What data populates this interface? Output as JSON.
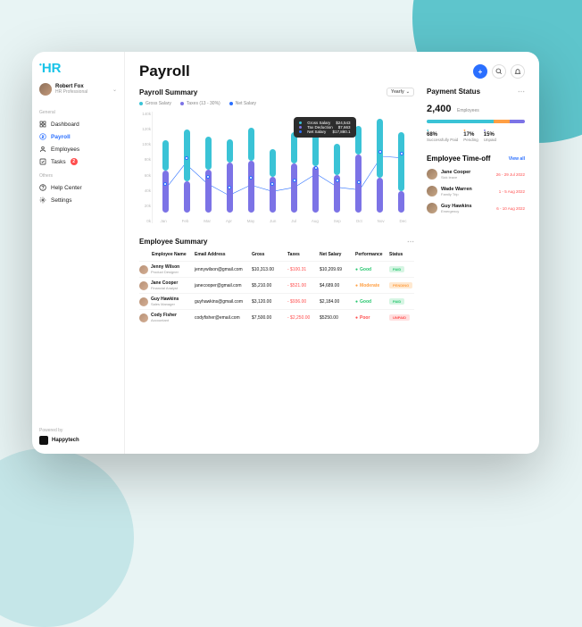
{
  "logo": "HR",
  "user": {
    "name": "Robert Fox",
    "role": "HR Professional"
  },
  "nav": {
    "sections": [
      {
        "label": "General",
        "items": [
          {
            "id": "dashboard",
            "label": "Dashboard",
            "icon": "grid-icon"
          },
          {
            "id": "payroll",
            "label": "Payroll",
            "icon": "dollar-icon",
            "active": true
          },
          {
            "id": "employees",
            "label": "Employees",
            "icon": "user-icon"
          },
          {
            "id": "tasks",
            "label": "Tasks",
            "icon": "check-icon",
            "badge": "2"
          }
        ]
      },
      {
        "label": "Others",
        "items": [
          {
            "id": "help",
            "label": "Help Center",
            "icon": "help-icon"
          },
          {
            "id": "settings",
            "label": "Settings",
            "icon": "gear-icon"
          }
        ]
      }
    ]
  },
  "powered": {
    "label": "Powered by",
    "name": "Happytech"
  },
  "page_title": "Payroll",
  "summary": {
    "title": "Payroll Summary",
    "period_selector": "Yearly",
    "legend": {
      "gross": "Gross Salary",
      "tax": "Taxes (13 - 30%)",
      "net": "Net Salary"
    },
    "tooltip": {
      "gross_label": "Gross Salary",
      "gross_val": "$24,543",
      "tax_label": "Tax Deduction",
      "tax_val": "$7,663",
      "net_label": "Net Salary",
      "net_val": "$17,880.1"
    }
  },
  "chart_data": {
    "type": "bar",
    "title": "Payroll Summary",
    "xlabel": "",
    "ylabel": "",
    "ylim": [
      0,
      140000
    ],
    "yticks": [
      "140k",
      "120k",
      "100k",
      "80k",
      "60k",
      "40k",
      "20k",
      "0k"
    ],
    "categories": [
      "Jan",
      "Feb",
      "Mar",
      "Apr",
      "May",
      "Jun",
      "Jul",
      "Aug",
      "Sep",
      "Oct",
      "Nov",
      "Dec"
    ],
    "series": [
      {
        "name": "Gross Salary",
        "color": "#3ac3d6",
        "values": [
          100000,
          115000,
          105000,
          102000,
          118000,
          88000,
          112000,
          125000,
          95000,
          120000,
          130000,
          112000
        ]
      },
      {
        "name": "Taxes",
        "color": "#7c73e6",
        "values": [
          58000,
          44000,
          60000,
          70000,
          72000,
          50000,
          68000,
          65000,
          52000,
          80000,
          48000,
          30000
        ]
      },
      {
        "name": "Net Salary",
        "color": "#2a6fff",
        "values": [
          40000,
          75000,
          50000,
          35000,
          48000,
          40000,
          45000,
          62000,
          45000,
          42000,
          84000,
          82000
        ]
      }
    ]
  },
  "payment_status": {
    "title": "Payment Status",
    "count": "2,400",
    "count_label": "Employees",
    "segments": [
      {
        "label": "Successfully Paid",
        "pct": 68,
        "color": "#3ac3d6"
      },
      {
        "label": "Pending",
        "pct": 17,
        "color": "#ff9f43"
      },
      {
        "label": "Unpaid",
        "pct": 15,
        "color": "#7c73e6"
      }
    ]
  },
  "timeoff": {
    "title": "Employee Time-off",
    "view_all": "View all",
    "items": [
      {
        "name": "Jane Cooper",
        "reason": "Sick leave",
        "date": "26 - 29 Jul 2022"
      },
      {
        "name": "Wade Warren",
        "reason": "Family Trip",
        "date": "1 - 5 Aug 2022"
      },
      {
        "name": "Guy Hawkins",
        "reason": "Emergency",
        "date": "6 - 10 Aug 2022"
      }
    ]
  },
  "employee_summary": {
    "title": "Employee Summary",
    "columns": [
      "Employee Name",
      "Email Address",
      "Gross",
      "Taxes",
      "Net Salary",
      "Performance",
      "Status"
    ],
    "rows": [
      {
        "name": "Jenny Wilson",
        "role": "Product Designer",
        "email": "jennywilson@gmail.com",
        "gross": "$10,313.00",
        "taxes": "- $100.31",
        "net": "$10,209.69",
        "perf": "Good",
        "perf_class": "good",
        "status": "PAID",
        "status_class": "st-paid"
      },
      {
        "name": "Jane Cooper",
        "role": "Financial Analyst",
        "email": "janecooper@gmail.com",
        "gross": "$5,210.00",
        "taxes": "- $521.00",
        "net": "$4,689.00",
        "perf": "Moderate",
        "perf_class": "mod",
        "status": "PENDING",
        "status_class": "st-pending"
      },
      {
        "name": "Guy Hawkins",
        "role": "Sales Manager",
        "email": "guyhawkins@gmail.com",
        "gross": "$3,120.00",
        "taxes": "- $936.00",
        "net": "$2,184.00",
        "perf": "Good",
        "perf_class": "good",
        "status": "PAID",
        "status_class": "st-paid"
      },
      {
        "name": "Cody Fisher",
        "role": "Accountant",
        "email": "codyfisher@email.com",
        "gross": "$7,500.00",
        "taxes": "- $2,250.00",
        "net": "$5250.00",
        "perf": "Poor",
        "perf_class": "poor",
        "status": "UNPAID",
        "status_class": "st-unpaid"
      }
    ]
  }
}
